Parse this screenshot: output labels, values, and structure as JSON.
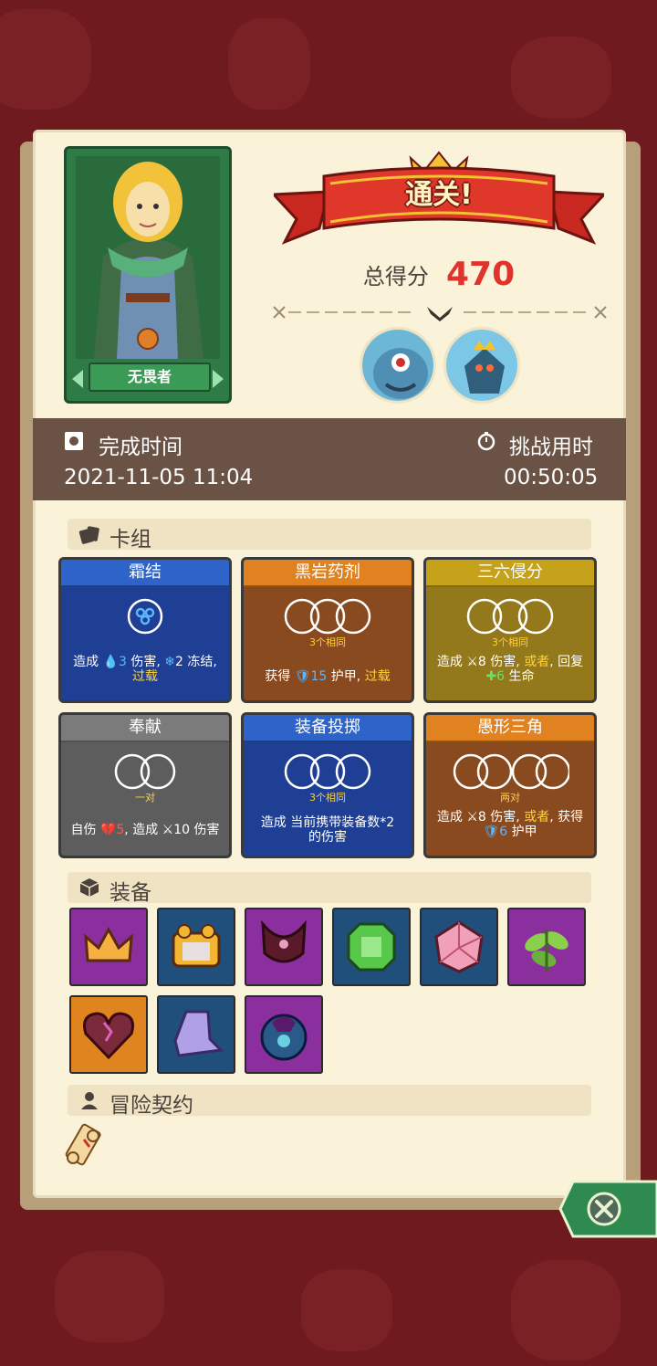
{
  "result": {
    "banner": "通关!",
    "score_label": "总得分",
    "score": "470"
  },
  "hero": {
    "name": "无畏者"
  },
  "time": {
    "finish_label": "完成时间",
    "finish_value": "2021-11-05 11:04",
    "challenge_label": "挑战用时",
    "challenge_value": "00:50:05"
  },
  "sections": {
    "deck": "卡组",
    "equipment": "装备",
    "contract": "冒险契约"
  },
  "deck": [
    {
      "name": "霜结",
      "color": "#2e63c9",
      "body": "#1f3f94",
      "sub": "",
      "d1": "造成",
      "d2": "3",
      "d3": "伤害,",
      "d4": "2",
      "d5": "冻结,",
      "d6": "过载"
    },
    {
      "name": "黑岩药剂",
      "color": "#e0821f",
      "body": "#8a4a1f",
      "sub": "3个相同",
      "d1": "获得",
      "d2": "15",
      "d3": "护甲,",
      "d4": "过载"
    },
    {
      "name": "三六侵分",
      "color": "#c5a21a",
      "body": "#94781c",
      "sub": "3个相同",
      "d1": "造成",
      "d2": "8",
      "d3": "伤害,",
      "d4": "或者",
      "d5": ", 回复",
      "d6": "6",
      "d7": "生命"
    },
    {
      "name": "奉献",
      "color": "#7b7b7b",
      "body": "#5d5d5d",
      "sub": "一对",
      "d1": "自伤",
      "d2": "5",
      "d3": ", 造成",
      "d4": "10",
      "d5": "伤害"
    },
    {
      "name": "装备投掷",
      "color": "#2e63c9",
      "body": "#1f3f94",
      "sub": "3个相同",
      "d1": "造成 当前携带装备数*2 的伤害"
    },
    {
      "name": "愚形三角",
      "color": "#e0821f",
      "body": "#8a4a1f",
      "sub": "两对",
      "d1": "造成",
      "d2": "8",
      "d3": "伤害,",
      "d4": "或者",
      "d5": ", 获得",
      "d6": "6",
      "d7": "护甲"
    }
  ],
  "equipment": [
    {
      "icon": "crown-icon",
      "color": "#8b2f9e"
    },
    {
      "icon": "treasure-chest-icon",
      "color": "#1f4f7a"
    },
    {
      "icon": "necklace-armor-icon",
      "color": "#8b2f9e"
    },
    {
      "icon": "emerald-gem-icon",
      "color": "#1f4f7a"
    },
    {
      "icon": "crystal-die-icon",
      "color": "#1f4f7a"
    },
    {
      "icon": "leaf-plant-icon",
      "color": "#8b2f9e"
    },
    {
      "icon": "cursed-heart-icon",
      "color": "#e0841f"
    },
    {
      "icon": "crystal-boot-icon",
      "color": "#1f4f7a"
    },
    {
      "icon": "dragon-amulet-icon",
      "color": "#8b2f9e"
    }
  ]
}
